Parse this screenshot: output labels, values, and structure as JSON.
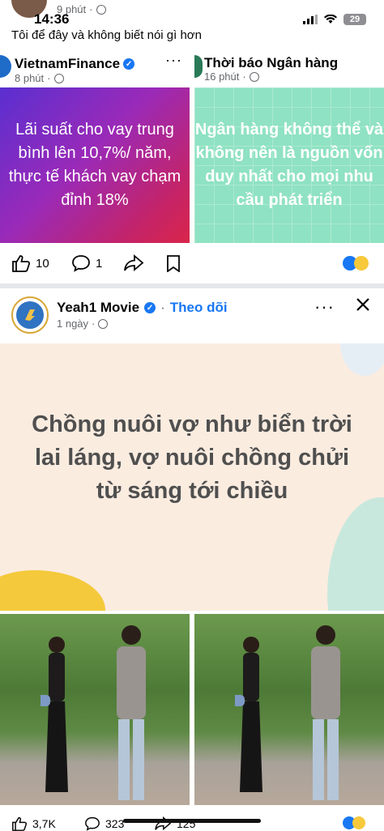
{
  "status_bar": {
    "time": "14:36",
    "battery": "29"
  },
  "previous_post": {
    "time": "9 phút",
    "caption": "Tôi để đây và không biết nói gì hơn"
  },
  "shared_posts": [
    {
      "page_name": "VietnamFinance",
      "time": "8 phút",
      "image_text": "Lãi suất cho vay trung bình lên 10,7%/ năm, thực tế khách vay chạm đỉnh 18%"
    },
    {
      "page_name": "Thời báo Ngân hàng",
      "time": "16 phút",
      "image_text": "Ngân hàng không thể và không nên là nguồn vốn duy nhất cho mọi nhu cầu phát triển"
    }
  ],
  "post1_actions": {
    "likes": "10",
    "comments": "1"
  },
  "post2": {
    "page_name": "Yeah1 Movie",
    "follow_label": "Theo dõi",
    "time": "1 ngày",
    "quote": "Chồng nuôi vợ như biển trời lai láng, vợ nuôi chồng chửi từ sáng tới chiều",
    "likes": "3,7K",
    "comments": "323",
    "shares": "125"
  },
  "icons": {
    "like": "thumbs-up-icon",
    "comment": "comment-icon",
    "share": "share-icon",
    "save": "bookmark-icon",
    "more": "more-icon",
    "close": "close-icon"
  },
  "colors": {
    "facebook_blue": "#1877f2",
    "meta_gray": "#65676b",
    "divider": "#e4e6eb"
  }
}
